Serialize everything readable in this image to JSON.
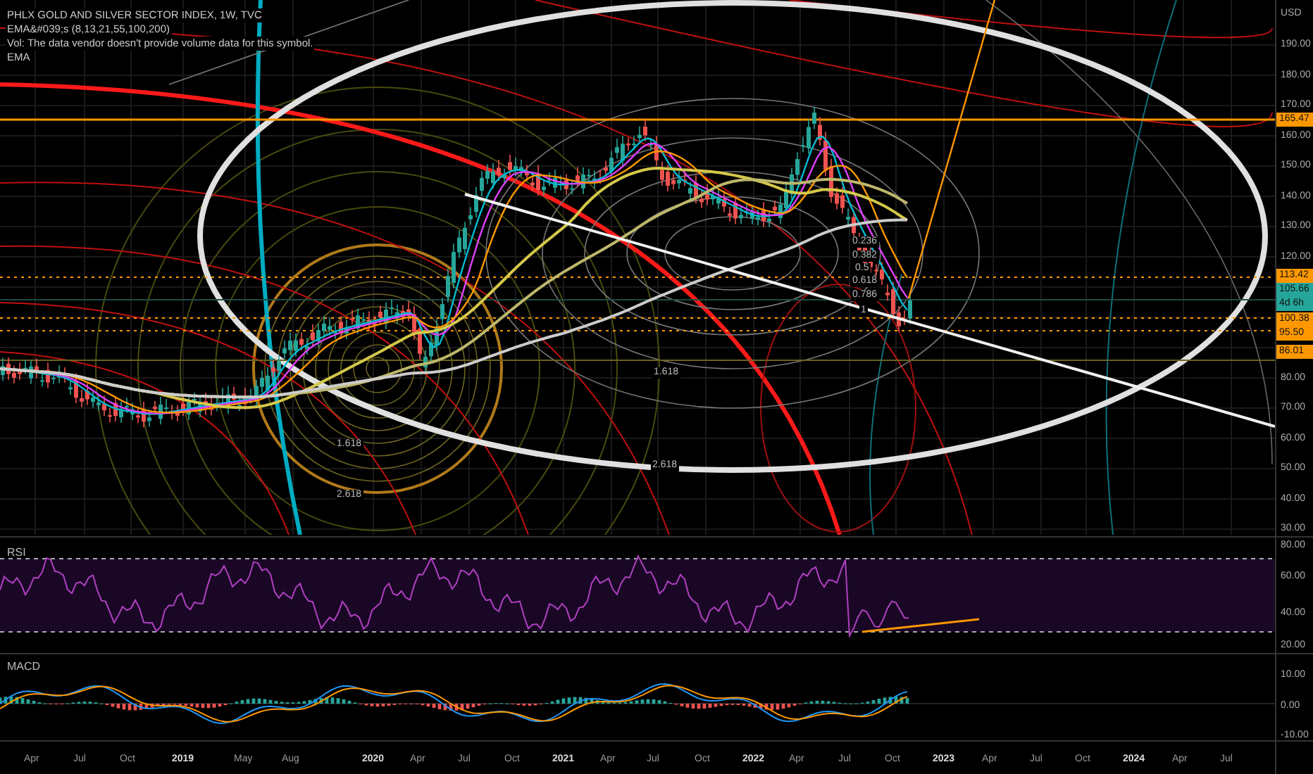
{
  "legend": {
    "title": "PHLX GOLD AND SILVER SECTOR INDEX, 1W, TVC",
    "lines": [
      "EMA&#039;s (8,13,21,55,100,200)",
      "Vol: The data vendor doesn't provide volume data for this symbol.",
      "EMA"
    ]
  },
  "price_axis": {
    "currency": "USD",
    "ticks": [
      "190.00",
      "180.00",
      "170.00",
      "160.00",
      "150.00",
      "140.00",
      "130.00",
      "120.00",
      "80.00",
      "70.00",
      "60.00",
      "50.00",
      "40.00",
      "30.00"
    ],
    "price_labels": [
      {
        "price": "165.47",
        "color": "#ff9800"
      },
      {
        "price": "113.42",
        "color": "#ff9800"
      },
      {
        "price": "105.66",
        "countdown": "4d 6h",
        "color": "#26a69a"
      },
      {
        "price": "100.38",
        "color": "#ff9800"
      },
      {
        "price": "95.50",
        "color": "#ff9800"
      },
      {
        "price": "86.01",
        "color": "#ff9800"
      }
    ]
  },
  "fib_levels": [
    "0.236",
    "0.382",
    "0.5",
    "0.618",
    "0.786",
    "1",
    "1.618",
    "2.618",
    "1.618",
    "2.618"
  ],
  "rsi_pane": {
    "title": "RSI",
    "ticks": [
      "80.00",
      "60.00",
      "40.00",
      "20.00"
    ]
  },
  "macd_pane": {
    "title": "MACD",
    "ticks": [
      "10.00",
      "0.00",
      "-10.00"
    ]
  },
  "time_axis": [
    {
      "label": "Apr",
      "year": false
    },
    {
      "label": "Jul",
      "year": false
    },
    {
      "label": "Oct",
      "year": false
    },
    {
      "label": "2019",
      "year": true
    },
    {
      "label": "May",
      "year": false
    },
    {
      "label": "Aug",
      "year": false
    },
    {
      "label": "2020",
      "year": true
    },
    {
      "label": "Apr",
      "year": false
    },
    {
      "label": "Jul",
      "year": false
    },
    {
      "label": "Oct",
      "year": false
    },
    {
      "label": "2021",
      "year": true
    },
    {
      "label": "Apr",
      "year": false
    },
    {
      "label": "Jul",
      "year": false
    },
    {
      "label": "Oct",
      "year": false
    },
    {
      "label": "2022",
      "year": true
    },
    {
      "label": "Apr",
      "year": false
    },
    {
      "label": "Jul",
      "year": false
    },
    {
      "label": "Oct",
      "year": false
    },
    {
      "label": "2023",
      "year": true
    },
    {
      "label": "Apr",
      "year": false
    },
    {
      "label": "Jul",
      "year": false
    },
    {
      "label": "Oct",
      "year": false
    },
    {
      "label": "2024",
      "year": true
    },
    {
      "label": "Apr",
      "year": false
    },
    {
      "label": "Jul",
      "year": false
    }
  ]
}
